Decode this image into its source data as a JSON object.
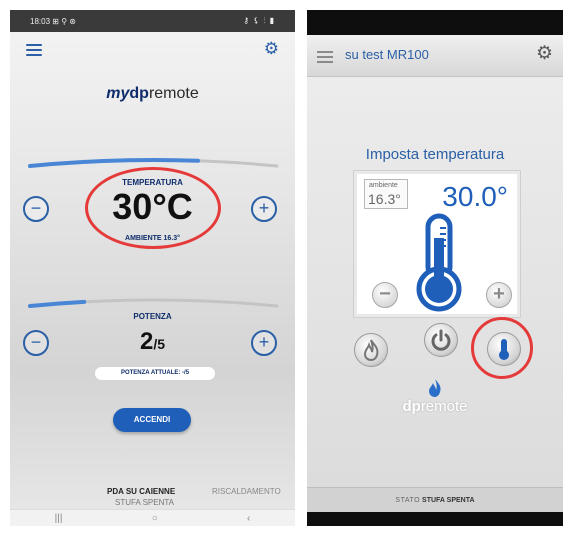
{
  "left_app": {
    "status_bar": {
      "time": "18:03",
      "left_icons": "⊞ ⚲ ⊛",
      "right_icons": "⚷ ⚸ ⫶ ▮"
    },
    "logo": {
      "my": "my",
      "dp": "dp",
      "rest": "remote"
    },
    "temperature": {
      "label": "TEMPERATURA",
      "value": "30°C",
      "ambient": "AMBIENTE 16.3°",
      "fill_fraction": 0.68
    },
    "power": {
      "label": "POTENZA",
      "value": "2",
      "max": "/5",
      "actual": "POTENZA ATTUALE: -/5",
      "fill_fraction": 0.22
    },
    "buttons": {
      "minus": "−",
      "plus": "+",
      "accendi": "ACCENDI"
    },
    "tabs": {
      "primary": "PDA SU CAIENNE",
      "primary_sub": "STUFA SPENTA",
      "secondary": "RISCALDAMENTO"
    },
    "navbar": {
      "recent": "|||",
      "home": "○",
      "back": "‹"
    },
    "colors": {
      "accent": "#2b5fa6",
      "highlight": "#e53a3a"
    }
  },
  "right_app": {
    "header_title": "su test MR100",
    "set_title": "Imposta temperatura",
    "ambient_label": "ambiente",
    "ambient_value": "16.3°",
    "temp_value": "30.0°",
    "controls": {
      "minus": "−",
      "plus": "+"
    },
    "modes": [
      "flame-mode",
      "power-mode",
      "thermostat-mode"
    ],
    "logo": {
      "dp": "dp",
      "rest": "remote"
    },
    "status": {
      "label": "STATO",
      "value": "STUFA SPENTA"
    },
    "colors": {
      "accent": "#1f5fb9"
    }
  }
}
